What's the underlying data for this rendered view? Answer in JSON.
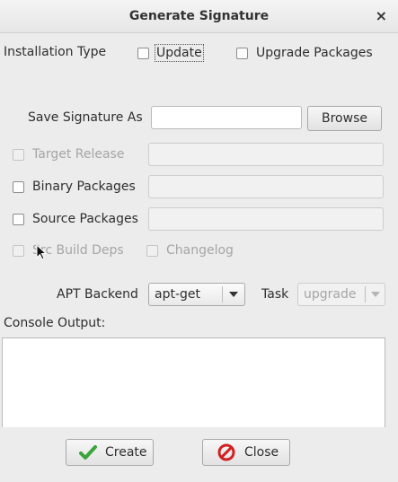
{
  "window": {
    "title": "Generate Signature",
    "close_glyph": "×"
  },
  "installation_type": {
    "label": "Installation Type",
    "update_label": "Update",
    "upgrade_packages_label": "Upgrade Packages"
  },
  "save_signature": {
    "label": "Save Signature As",
    "value": "",
    "browse_label": "Browse"
  },
  "target_release": {
    "label": "Target Release",
    "value": ""
  },
  "binary_packages": {
    "label": "Binary Packages",
    "value": ""
  },
  "source_packages": {
    "label": "Source Packages",
    "value": ""
  },
  "src_build_deps": {
    "label": "Src Build Deps"
  },
  "changelog": {
    "label": "Changelog"
  },
  "apt_backend": {
    "label": "APT Backend",
    "value": "apt-get"
  },
  "task": {
    "label": "Task",
    "value": "upgrade"
  },
  "console": {
    "label": "Console Output:",
    "text": ""
  },
  "actions": {
    "create_label": "Create",
    "close_label": "Close"
  },
  "colors": {
    "create_icon": "#3aa53a",
    "close_icon": "#d21f1f"
  }
}
